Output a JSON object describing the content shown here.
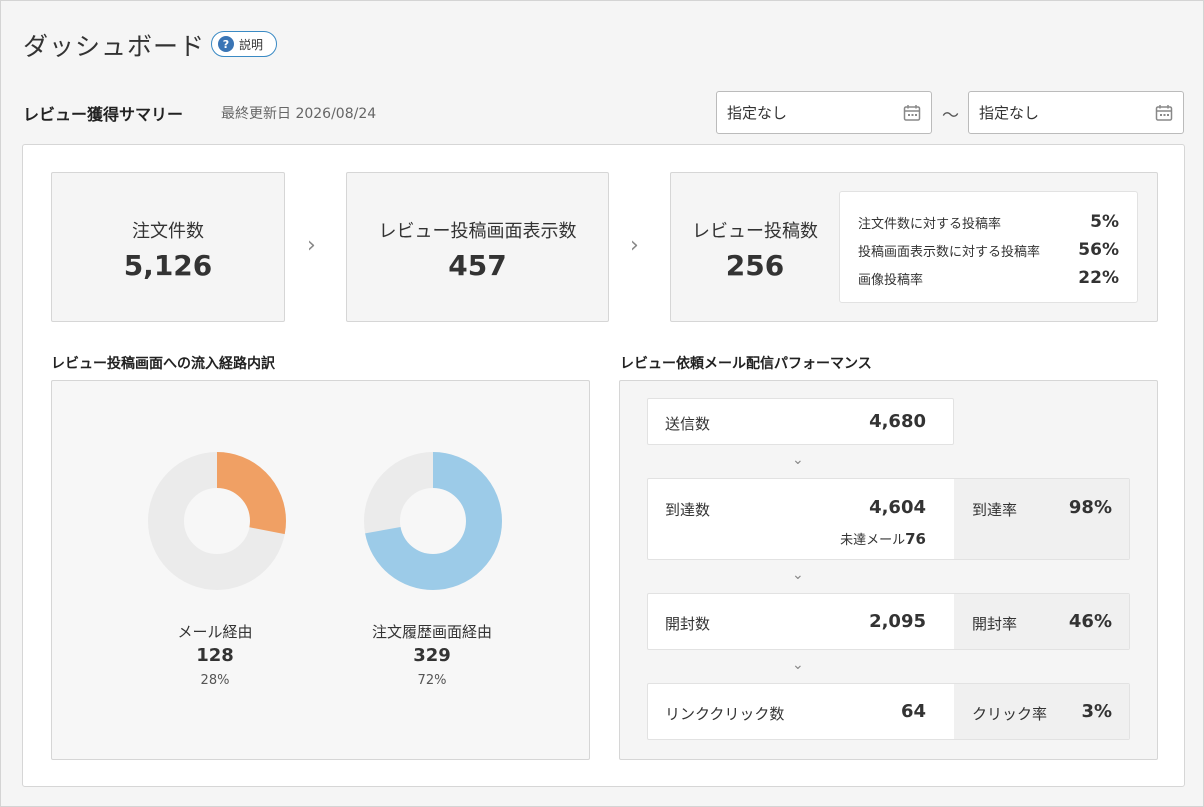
{
  "header": {
    "title": "ダッシュボード",
    "help_label": "説明"
  },
  "summary": {
    "title": "レビュー獲得サマリー",
    "updated": "最終更新日 2026/08/24",
    "date_from": "指定なし",
    "date_to": "指定なし",
    "tilde": "～"
  },
  "kpis": [
    {
      "label": "注文件数",
      "value": "5,126"
    },
    {
      "label": "レビュー投稿画面表示数",
      "value": "457"
    },
    {
      "label": "レビュー投稿数",
      "value": "256"
    }
  ],
  "rates": [
    {
      "label": "注文件数に対する投稿率",
      "value": "5%"
    },
    {
      "label": "投稿画面表示数に対する投稿率",
      "value": "56%"
    },
    {
      "label": "画像投稿率",
      "value": "22%"
    }
  ],
  "sections": {
    "inflow": "レビュー投稿画面への流入経路内訳",
    "mail": "レビュー依頼メール配信パフォーマンス"
  },
  "inflow": [
    {
      "label": "メール経由",
      "count": "128",
      "pct": "28%",
      "fraction": 0.28,
      "color": "#f0a064"
    },
    {
      "label": "注文履歴画面経由",
      "count": "329",
      "pct": "72%",
      "fraction": 0.72,
      "color": "#9ccbe8"
    }
  ],
  "funnel": {
    "sent": {
      "label": "送信数",
      "value": "4,680"
    },
    "delivered": {
      "label": "到達数",
      "value": "4,604",
      "sub_label": "未達メール",
      "sub_value": "76",
      "rate_label": "到達率",
      "rate_value": "98%"
    },
    "opened": {
      "label": "開封数",
      "value": "2,095",
      "rate_label": "開封率",
      "rate_value": "46%"
    },
    "clicked": {
      "label": "リンククリック数",
      "value": "64",
      "rate_label": "クリック率",
      "rate_value": "3%"
    }
  },
  "colors": {
    "accent": "#3a8ac4",
    "donut_track": "#ebebeb"
  }
}
